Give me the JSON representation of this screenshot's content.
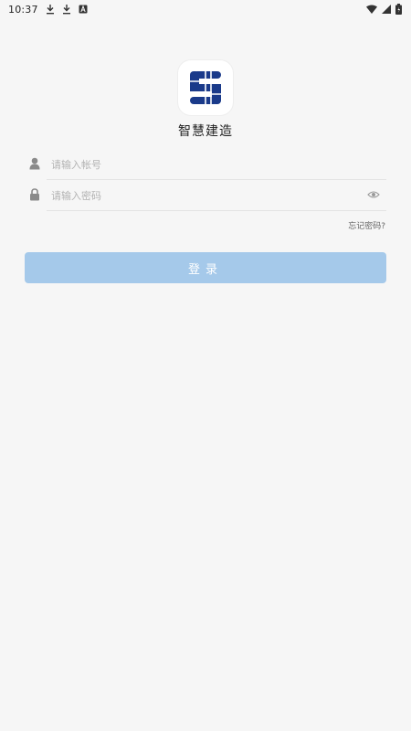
{
  "status_bar": {
    "time": "10:37",
    "icons": [
      "download-icon",
      "download-icon",
      "a-icon"
    ],
    "right_icons": [
      "wifi-icon",
      "signal-icon",
      "battery-icon"
    ]
  },
  "app": {
    "name": "智慧建造",
    "logo_icon": "company-logo-icon",
    "brand_color": "#1a3a8a"
  },
  "form": {
    "account": {
      "placeholder": "请输入帐号",
      "value": "",
      "icon": "user-icon"
    },
    "password": {
      "placeholder": "请输入密码",
      "value": "",
      "icon": "lock-icon",
      "toggle_icon": "eye-icon"
    },
    "forgot_label": "忘记密码?",
    "login_label": "登录",
    "login_color": "#a5c9ea"
  }
}
